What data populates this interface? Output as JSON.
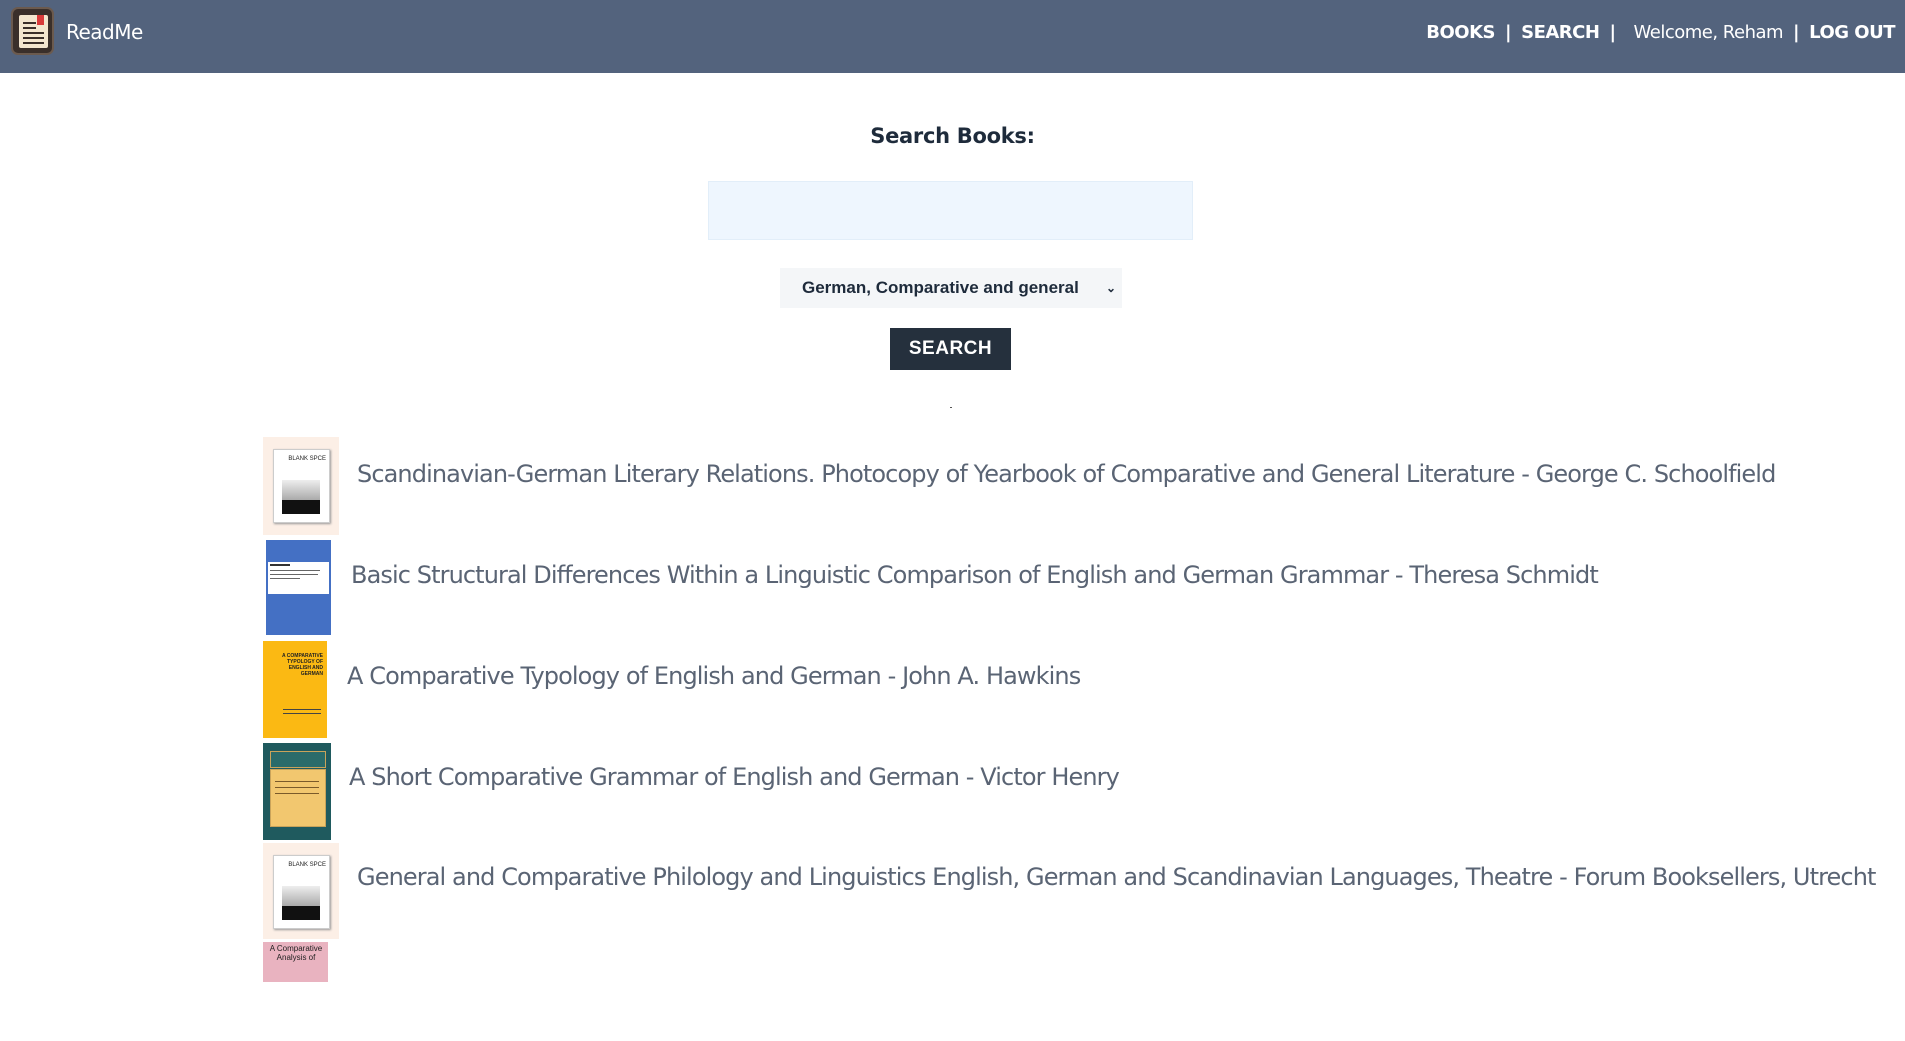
{
  "nav": {
    "brand": "ReadMe",
    "books": "BOOKS",
    "search": "SEARCH",
    "sep": "|",
    "welcome": "Welcome, Reham",
    "logout": "LOG OUT"
  },
  "search": {
    "title": "Search Books:",
    "input_value": "",
    "category_selected": "German, Comparative and general",
    "button_label": "SEARCH"
  },
  "results": [
    {
      "title": "Scandinavian-German Literary Relations. Photocopy of Yearbook of Comparative and General Literature - George C. Schoolfield",
      "cover": "blank-space",
      "cover_text": "BLANK SPCE"
    },
    {
      "title": "Basic Structural Differences Within a Linguistic Comparison of English and German Grammar - Theresa Schmidt",
      "cover": "blue"
    },
    {
      "title": "A Comparative Typology of English and German - John A. Hawkins",
      "cover": "yellow",
      "cover_text": "A COMPARATIVE TYPOLOGY OF ENGLISH AND GERMAN"
    },
    {
      "title": "A Short Comparative Grammar of English and German - Victor Henry",
      "cover": "teal"
    },
    {
      "title": "General and Comparative Philology and Linguistics English, German and Scandinavian Languages, Theatre - Forum Booksellers, Utrecht",
      "cover": "blank-space",
      "cover_text": "BLANK SPCE"
    },
    {
      "title": "",
      "cover": "pink",
      "cover_text": "A Comparative Analysis of"
    }
  ],
  "colors": {
    "navbar": "#53637d",
    "button": "#25303d",
    "input_bg": "#eef6fe",
    "title_text": "#5a6474"
  }
}
